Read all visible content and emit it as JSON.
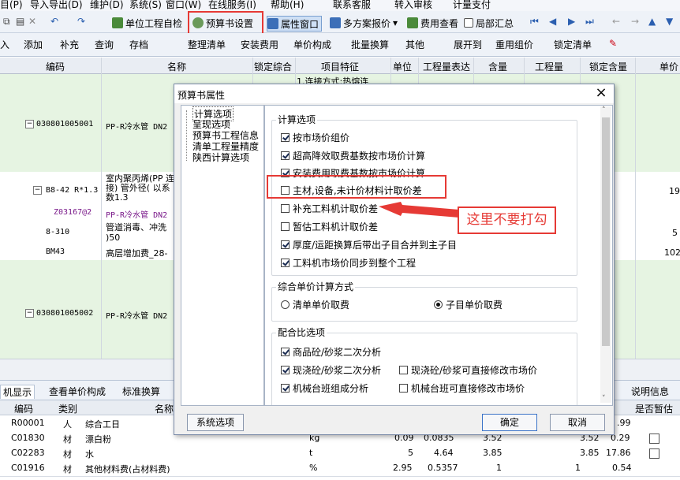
{
  "menu": [
    "目(P)",
    "导入导出(D)",
    "维护(D)",
    "系统(S)",
    "窗口(W)",
    "在线服务(I)",
    "帮助(H)",
    "联系客服",
    "转入审核",
    "计量支付"
  ],
  "toolbar1": {
    "unit_check": "单位工程自检",
    "budget_settings": "预算书设置",
    "property_window": "属性窗口",
    "multi_report": "多方案报价",
    "fee_view": "费用查看",
    "local_summary": "局部汇总"
  },
  "toolbar2": [
    "入",
    "添加",
    "补充",
    "查询",
    "存档",
    "整理清单",
    "安装费用",
    "单价构成",
    "批量换算",
    "其他",
    "展开到",
    "重用组价",
    "锁定清单"
  ],
  "grid": {
    "headers": [
      "编码",
      "名称",
      "锁定综合",
      "项目特征",
      "单位",
      "工程量表达",
      "含量",
      "工程量",
      "锁定含量",
      "单价"
    ],
    "rows": [
      {
        "code": "030801005001",
        "name": "PP-R冷水管 DN2",
        "feature": "1.连接方式:热熔连"
      },
      {
        "code": "B8-42 R*1.3",
        "name": "室内聚丙烯(PP 连接) 管外径( 以系数1.3",
        "price": "19"
      },
      {
        "code": "Z03167@2",
        "name": "PP-R冷水管 DN2"
      },
      {
        "code": "8-310",
        "name": "管道消毒、冲洗 )50",
        "price": "5"
      },
      {
        "code": "BM43",
        "name": "高层增加费_28-",
        "price": "102"
      },
      {
        "code": "030801005002",
        "name": "PP-R冷水管 DN2"
      }
    ]
  },
  "bottom_tabs": [
    "机显示",
    "查看单价构成",
    "标准换算",
    "说明信息"
  ],
  "bottom_grid": {
    "headers": [
      "编码",
      "类别",
      "名称",
      "是否暂估"
    ],
    "rows": [
      {
        "code": "R00001",
        "type": "人",
        "name": "综合工日",
        "unit": "",
        "a": "",
        "b": "",
        "c": "",
        "d": "",
        "e": ".99"
      },
      {
        "code": "C01830",
        "type": "材",
        "name": "漂白粉",
        "unit": "kg",
        "a": "0.09",
        "b": "0.0835",
        "c": "3.52",
        "d": "3.52",
        "e": "0.29"
      },
      {
        "code": "C02283",
        "type": "材",
        "name": "水",
        "unit": "t",
        "a": "5",
        "b": "4.64",
        "c": "3.85",
        "d": "3.85",
        "e": "17.86"
      },
      {
        "code": "C01916",
        "type": "材",
        "name": "其他材料费(占材料费)",
        "unit": "%",
        "a": "2.95",
        "b": "0.5357",
        "c": "1",
        "d": "1",
        "e": "0.54"
      }
    ]
  },
  "dialog": {
    "title": "预算书属性",
    "close": "×",
    "tree": [
      "计算选项",
      "呈现选项",
      "预算书工程信息",
      "清单工程量精度",
      "陕西计算选项"
    ],
    "group1_title": "计算选项",
    "options": [
      {
        "label": "按市场价组价",
        "checked": true
      },
      {
        "label": "超高降效取费基数按市场价计算",
        "checked": true
      },
      {
        "label": "安装费用取费基数按市场价计算",
        "checked": true
      },
      {
        "label": "主材,设备,未计价材料计取价差",
        "checked": false
      },
      {
        "label": "补充工料机计取价差",
        "checked": false
      },
      {
        "label": "暂估工料机计取价差",
        "checked": false
      },
      {
        "label": "厚度/运距换算后带出子目合并到主子目",
        "checked": true
      },
      {
        "label": "工料机市场价同步到整个工程",
        "checked": true
      }
    ],
    "group2_title": "综合单价计算方式",
    "radio_list": "清单单价取费",
    "radio_sub": "子目单价取费",
    "group3_title": "配合比选项",
    "mix_options": [
      {
        "label": "商品砼/砂浆二次分析",
        "checked": true
      },
      {
        "label": "现浇砼/砂浆二次分析",
        "checked": true
      },
      {
        "label": "现浇砼/砂浆可直接修改市场价",
        "checked": false
      },
      {
        "label": "机械台班组成分析",
        "checked": true
      },
      {
        "label": "机械台班可直接修改市场价",
        "checked": false
      }
    ],
    "system_options": "系统选项",
    "ok": "确定",
    "cancel": "取消"
  },
  "annotation": "这里不要打勾",
  "colors": {
    "accent": "#e63a35",
    "row_green": "#e6f4e2"
  }
}
